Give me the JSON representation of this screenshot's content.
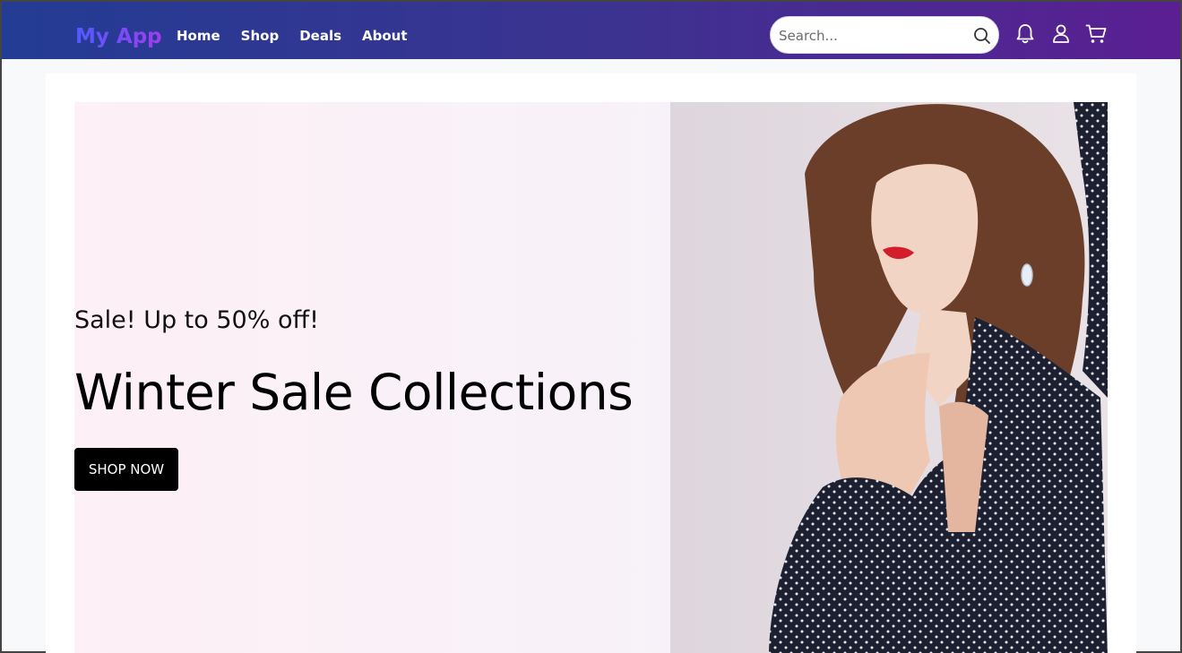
{
  "header": {
    "logo": "My App",
    "nav": [
      "Home",
      "Shop",
      "Deals",
      "About"
    ],
    "search_placeholder": "Search..."
  },
  "hero": {
    "subtitle": "Sale! Up to 50% off!",
    "title": "Winter Sale Collections",
    "cta_label": "SHOP NOW",
    "image": "woman-in-polka-dot-blouse-photo"
  },
  "icons": [
    "search-icon",
    "bell-icon",
    "user-icon",
    "cart-icon"
  ],
  "colors": {
    "navbar_start": "#233c94",
    "navbar_end": "#5b1f93",
    "logo_start": "#4f5bff",
    "logo_end": "#a33bf0",
    "cta_bg": "#000000"
  }
}
